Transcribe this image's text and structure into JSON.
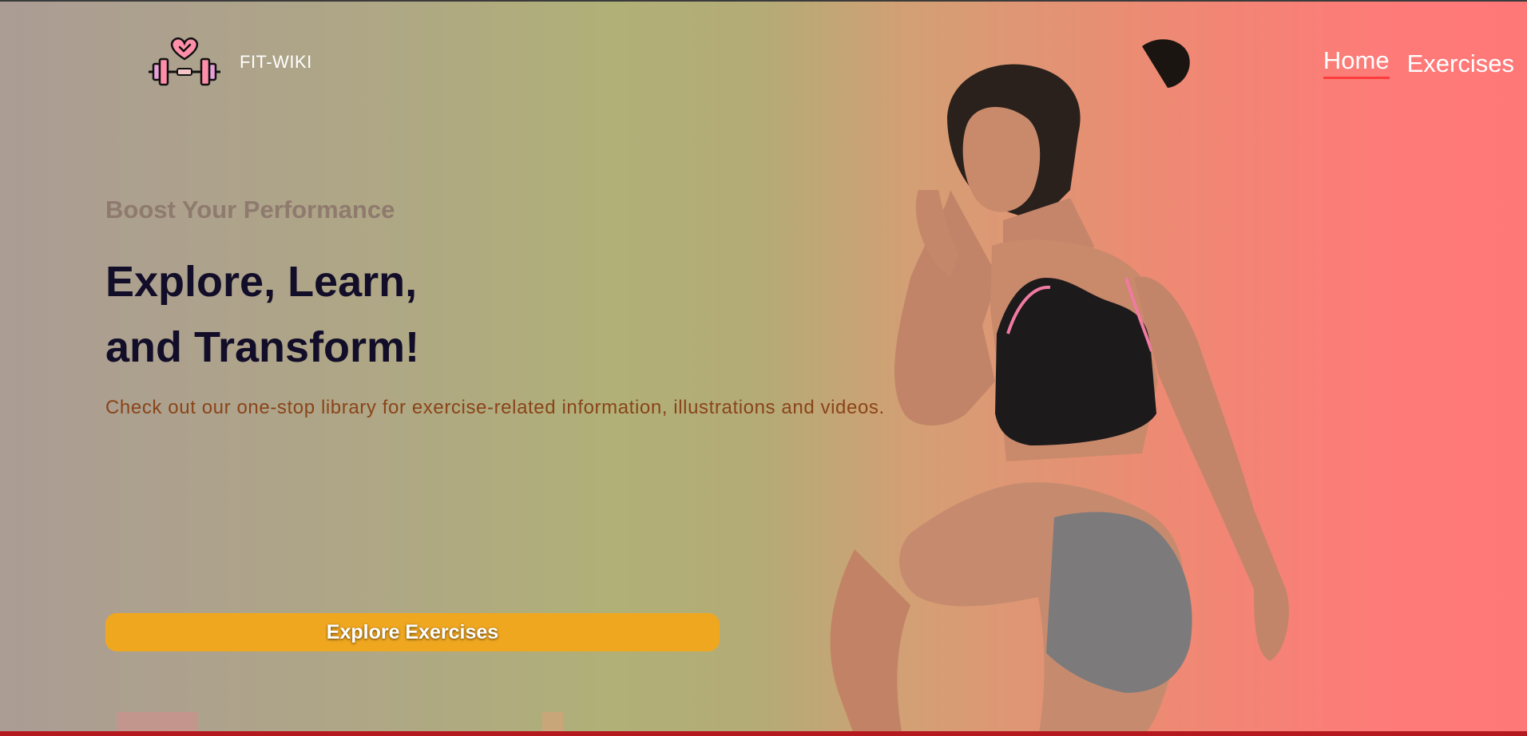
{
  "header": {
    "brand": "FIT-WIKI",
    "logo_icon": "dumbbell-heart-icon",
    "nav": [
      {
        "label": "Home",
        "active": true
      },
      {
        "label": "Exercises",
        "active": false
      }
    ]
  },
  "hero": {
    "subtitle": "Boost Your Performance",
    "headline_line1": "Explore, Learn,",
    "headline_line2": "and Transform!",
    "description": "Check out our one-stop library for exercise-related information, illustrations and videos.",
    "cta_label": "Explore Exercises",
    "image": "athlete-woman-running"
  },
  "colors": {
    "accent": "#f0a720",
    "nav_underline": "#ff3b3b",
    "headline": "#120d28",
    "subtitle": "#8f7a6e",
    "description": "#8a4419",
    "footer_bar": "#b3191f"
  }
}
